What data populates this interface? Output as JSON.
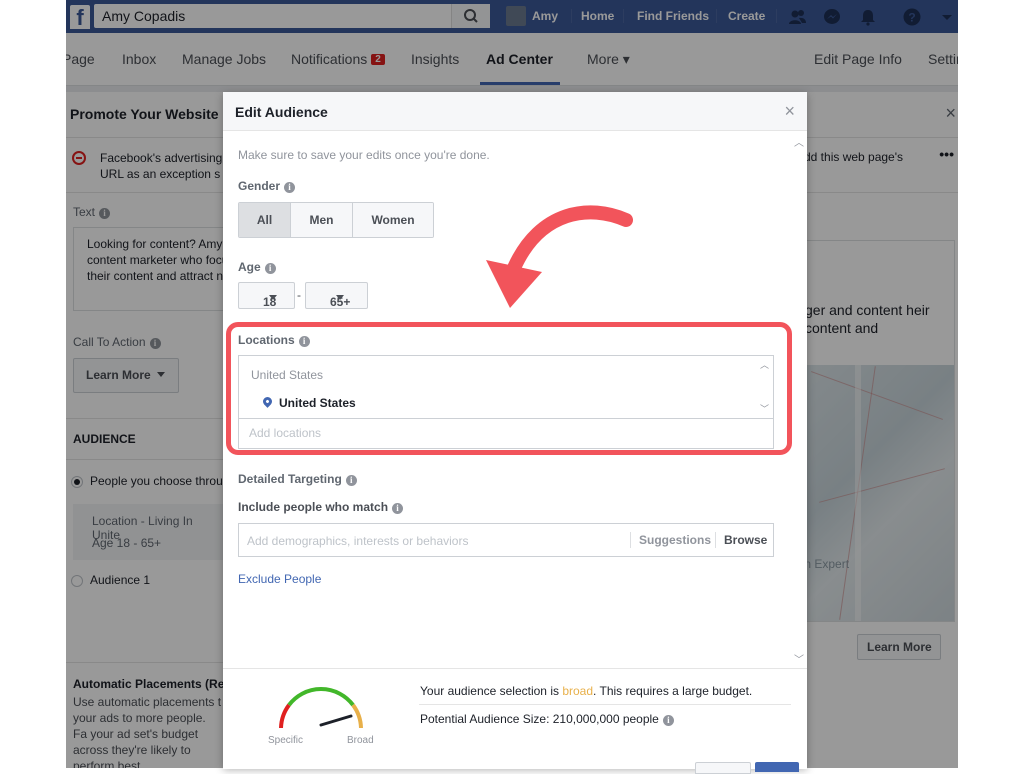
{
  "topbar": {
    "logo": "f",
    "search_value": "Amy Copadis",
    "user_name": "Amy",
    "home": "Home",
    "find_friends": "Find Friends",
    "create": "Create"
  },
  "pagenav": {
    "items": [
      "Page",
      "Inbox",
      "Manage Jobs",
      "Notifications",
      "Insights",
      "Ad Center",
      "More ▾",
      "Edit Page Info",
      "Settings"
    ],
    "notifications_count": "2"
  },
  "background": {
    "title": "Promote Your Website",
    "close": "×",
    "warning_text": "Facebook's advertising URL as an exception s",
    "warning_right": "dd this web page's",
    "dots": "•••",
    "text_label": "Text",
    "text_body": "Looking for content? Amy content marketer who focu their content and attract ne",
    "cta_label": "Call To Action",
    "cta_value": "Learn More",
    "audience_heading": "AUDIENCE",
    "audience_option1": "People you choose throu",
    "location_line": "Location - Living In Unite",
    "age_line": "Age 18 - 65+",
    "audience_option2": "Audience 1",
    "right_text": "ger and content heir content and",
    "map_caption": "ion Expert",
    "learn_more": "Learn More",
    "auto_title": "Automatic Placements (Rec",
    "auto_body": "Use automatic placements t your ads to more people. Fa your ad set's budget across they're likely to perform best."
  },
  "modal": {
    "title": "Edit Audience",
    "close": "×",
    "hint": "Make sure to save your edits once you're done.",
    "gender_label": "Gender",
    "gender_options": [
      "All",
      "Men",
      "Women"
    ],
    "gender_selected": "All",
    "age_label": "Age",
    "age_min": "18",
    "age_dash": "-",
    "age_max": "65+",
    "locations_label": "Locations",
    "location_group": "United States",
    "location_item": "United States",
    "add_locations_placeholder": "Add locations",
    "detailed_targeting_label": "Detailed Targeting",
    "include_label": "Include people who match",
    "targeting_placeholder": "Add demographics, interests or behaviors",
    "suggestions": "Suggestions",
    "browse": "Browse",
    "exclude_link": "Exclude People",
    "footer": {
      "selection_prefix": "Your audience selection is ",
      "selection_word": "broad",
      "selection_suffix": ". This requires a large budget.",
      "potential_size": "Potential Audience Size: 210,000,000 people",
      "gauge_specific": "Specific",
      "gauge_broad": "Broad"
    }
  },
  "colors": {
    "facebook_blue": "#3b5998",
    "highlight": "#f2545b",
    "broad": "#e8b04a",
    "link": "#4267b2"
  }
}
